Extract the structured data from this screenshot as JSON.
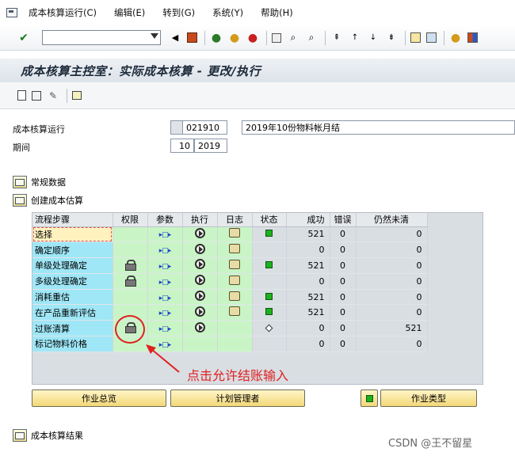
{
  "menu": [
    "成本核算运行(C)",
    "编辑(E)",
    "转到(G)",
    "系统(Y)",
    "帮助(H)"
  ],
  "title": "成本核算主控室：实际成本核算 - 更改/执行",
  "form": {
    "run_label": "成本核算运行",
    "run_id": "021910",
    "run_desc": "2019年10份物料帐月结",
    "period_label": "期间",
    "period_value": "10",
    "year_value": "2019"
  },
  "sections": {
    "general": "常规数据",
    "create": "创建成本估算",
    "results": "成本核算结果"
  },
  "table": {
    "headers": [
      "流程步骤",
      "权限",
      "参数",
      "执行",
      "日志",
      "状态",
      "成功",
      "错误",
      "仍然未清"
    ],
    "rows": [
      {
        "step": "选择",
        "lock": false,
        "status": "green",
        "success": "521",
        "error": "0",
        "open": "0"
      },
      {
        "step": "确定顺序",
        "lock": false,
        "status": "",
        "success": "0",
        "error": "0",
        "open": "0"
      },
      {
        "step": "单级处理确定",
        "lock": true,
        "status": "green",
        "success": "521",
        "error": "0",
        "open": "0"
      },
      {
        "step": "多级处理确定",
        "lock": true,
        "status": "",
        "success": "0",
        "error": "0",
        "open": "0"
      },
      {
        "step": "消耗重估",
        "lock": false,
        "status": "green",
        "success": "521",
        "error": "0",
        "open": "0"
      },
      {
        "step": "在产品重新评估",
        "lock": false,
        "status": "green",
        "success": "521",
        "error": "0",
        "open": "0"
      },
      {
        "step": "过账清算",
        "lock": true,
        "status": "diamond",
        "success": "0",
        "error": "0",
        "open": "521"
      },
      {
        "step": "标记物料价格",
        "lock": false,
        "status": "",
        "success": "0",
        "error": "0",
        "open": "0"
      }
    ]
  },
  "annotation": "点击允许结账输入",
  "buttons": {
    "job_overview": "作业总览",
    "plan_manager": "计划管理者",
    "job_type": "作业类型"
  },
  "watermark": "CSDN @王不留星",
  "colors": {
    "step_cell": "#9fe7f7",
    "green_cell": "#c9f5c6",
    "annotation": "#e02020",
    "button": "#f3d879"
  }
}
